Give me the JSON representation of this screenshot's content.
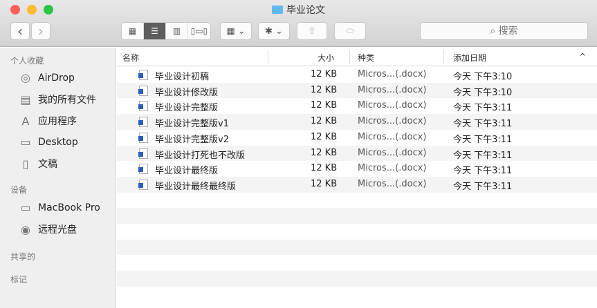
{
  "window": {
    "title": "毕业论文"
  },
  "toolbar": {
    "back": "‹",
    "forward": "›",
    "search_placeholder": "搜索"
  },
  "sidebar": {
    "sections": [
      {
        "title": "个人收藏",
        "items": [
          {
            "label": "AirDrop",
            "icon": "airdrop-icon",
            "glyph": "◎"
          },
          {
            "label": "我的所有文件",
            "icon": "all-files-icon",
            "glyph": "▤"
          },
          {
            "label": "应用程序",
            "icon": "applications-icon",
            "glyph": "A"
          },
          {
            "label": "Desktop",
            "icon": "desktop-icon",
            "glyph": "▭"
          },
          {
            "label": "文稿",
            "icon": "documents-icon",
            "glyph": "▯"
          }
        ]
      },
      {
        "title": "设备",
        "items": [
          {
            "label": "MacBook Pro",
            "icon": "laptop-icon",
            "glyph": "▭"
          },
          {
            "label": "远程光盘",
            "icon": "disc-icon",
            "glyph": "◉"
          }
        ]
      },
      {
        "title": "共享的",
        "items": []
      },
      {
        "title": "标记",
        "items": []
      }
    ]
  },
  "columns": {
    "name": "名称",
    "size": "大小",
    "kind": "种类",
    "date": "添加日期"
  },
  "files": [
    {
      "name": "毕业设计初稿",
      "size": "12 KB",
      "kind": "Micros...(.docx)",
      "date": "今天 下午3:10"
    },
    {
      "name": "毕业设计修改版",
      "size": "12 KB",
      "kind": "Micros...(.docx)",
      "date": "今天 下午3:10"
    },
    {
      "name": "毕业设计完整版",
      "size": "12 KB",
      "kind": "Micros...(.docx)",
      "date": "今天 下午3:11"
    },
    {
      "name": "毕业设计完整版v1",
      "size": "12 KB",
      "kind": "Micros...(.docx)",
      "date": "今天 下午3:11"
    },
    {
      "name": "毕业设计完整版v2",
      "size": "12 KB",
      "kind": "Micros...(.docx)",
      "date": "今天 下午3:11"
    },
    {
      "name": "毕业设计打死也不改版",
      "size": "12 KB",
      "kind": "Micros...(.docx)",
      "date": "今天 下午3:11"
    },
    {
      "name": "毕业设计最终版",
      "size": "12 KB",
      "kind": "Micros...(.docx)",
      "date": "今天 下午3:11"
    },
    {
      "name": "毕业设计最终最终版",
      "size": "12 KB",
      "kind": "Micros...(.docx)",
      "date": "今天 下午3:11"
    }
  ]
}
